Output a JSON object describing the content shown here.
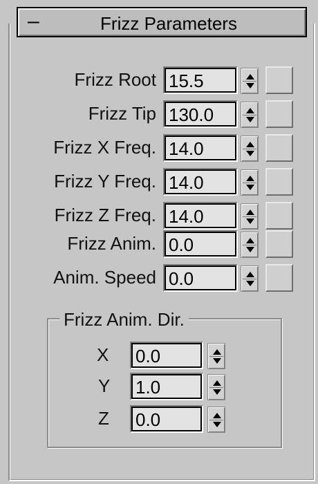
{
  "rollout": {
    "collapse_symbol": "–",
    "title": "Frizz Parameters"
  },
  "params": [
    {
      "label": "Frizz Root",
      "value": "15.5"
    },
    {
      "label": "Frizz Tip",
      "value": "130.0"
    },
    {
      "label": "Frizz X Freq.",
      "value": "14.0"
    },
    {
      "label": "Frizz Y Freq.",
      "value": "14.0"
    },
    {
      "label": "Frizz Z Freq.",
      "value": "14.0"
    },
    {
      "label": "Frizz Anim.",
      "value": "0.0"
    },
    {
      "label": "Anim. Speed",
      "value": "0.0"
    }
  ],
  "anim_dir": {
    "title": "Frizz Anim. Dir.",
    "axes": [
      {
        "label": "X",
        "value": "0.0"
      },
      {
        "label": "Y",
        "value": "1.0"
      },
      {
        "label": "Z",
        "value": "0.0"
      }
    ]
  }
}
